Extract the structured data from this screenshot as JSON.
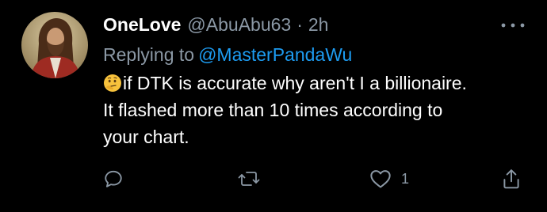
{
  "tweet": {
    "display_name": "OneLove",
    "handle": "@AbuAbu63",
    "separator": "·",
    "time": "2h",
    "replying_label": "Replying to",
    "replying_to": "@MasterPandaWu",
    "text_lines": [
      "if DTK is accurate why aren't I a billionaire.",
      "It flashed more than 10 times according to",
      "your chart."
    ],
    "emoji": "thinking-face-emoji"
  },
  "actions": {
    "reply_icon": "comment-icon",
    "retweet_icon": "retweet-icon",
    "like_icon": "heart-icon",
    "like_count": "1",
    "share_icon": "share-icon"
  },
  "colors": {
    "background": "#000000",
    "text": "#ffffff",
    "secondary": "#8b98a5",
    "link": "#1d9bf0"
  }
}
